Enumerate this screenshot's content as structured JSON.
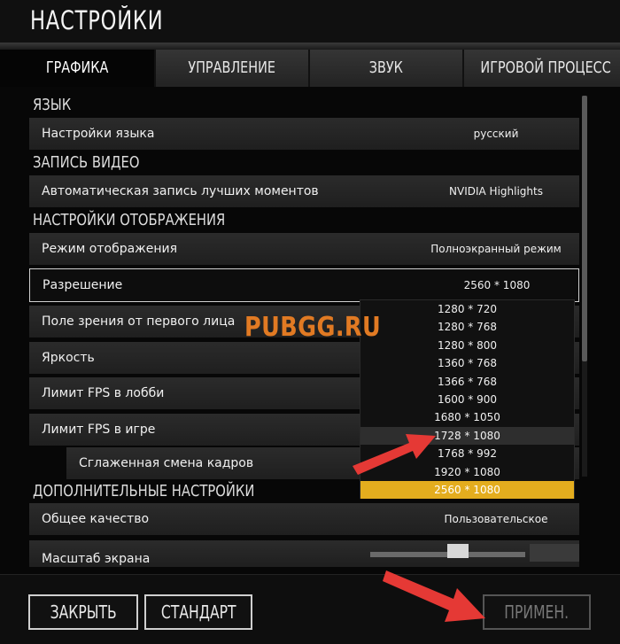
{
  "title": "НАСТРОЙКИ",
  "tabs": [
    {
      "label": "ГРАФИКА",
      "active": true
    },
    {
      "label": "УПРАВЛЕНИЕ",
      "active": false
    },
    {
      "label": "ЗВУК",
      "active": false
    },
    {
      "label": "ИГРОВОЙ ПРОЦЕСС",
      "active": false
    }
  ],
  "sections": {
    "language": "ЯЗЫК",
    "video_record": "ЗАПИСЬ ВИДЕО",
    "display": "НАСТРОЙКИ ОТОБРАЖЕНИЯ",
    "advanced": "ДОПОЛНИТЕЛЬНЫЕ НАСТРОЙКИ"
  },
  "rows": {
    "language": {
      "label": "Настройки языка",
      "value": "русский"
    },
    "auto_record": {
      "label": "Автоматическая запись лучших моментов",
      "value": "NVIDIA Highlights"
    },
    "display_mode": {
      "label": "Режим отображения",
      "value": "Полноэкранный режим"
    },
    "resolution": {
      "label": "Разрешение",
      "value": "2560 * 1080"
    },
    "fov": {
      "label": "Поле зрения от первого лица"
    },
    "brightness": {
      "label": "Яркость"
    },
    "fps_lobby": {
      "label": "Лимит FPS в лобби"
    },
    "fps_game": {
      "label": "Лимит FPS в игре"
    },
    "smooth_frames": {
      "label": "Сглаженная смена кадров"
    },
    "overall_quality": {
      "label": "Общее качество",
      "value": "Пользовательское"
    },
    "screen_scale": {
      "label": "Масштаб экрана"
    }
  },
  "resolution_options": [
    "1280 * 720",
    "1280 * 768",
    "1280 * 800",
    "1360 * 768",
    "1366 * 768",
    "1600 * 900",
    "1680 * 1050",
    "1728 * 1080",
    "1768 * 992",
    "1920 * 1080",
    "2560 * 1080"
  ],
  "resolution_hovered": "1728 * 1080",
  "resolution_selected": "2560 * 1080",
  "watermark": "PUBGG.RU",
  "buttons": {
    "close": "ЗАКРЫТЬ",
    "default": "СТАНДАРТ",
    "apply": "ПРИМЕН."
  },
  "colors": {
    "accent": "#e4ad1e",
    "watermark": "#e17a23",
    "arrow": "#e53935"
  }
}
